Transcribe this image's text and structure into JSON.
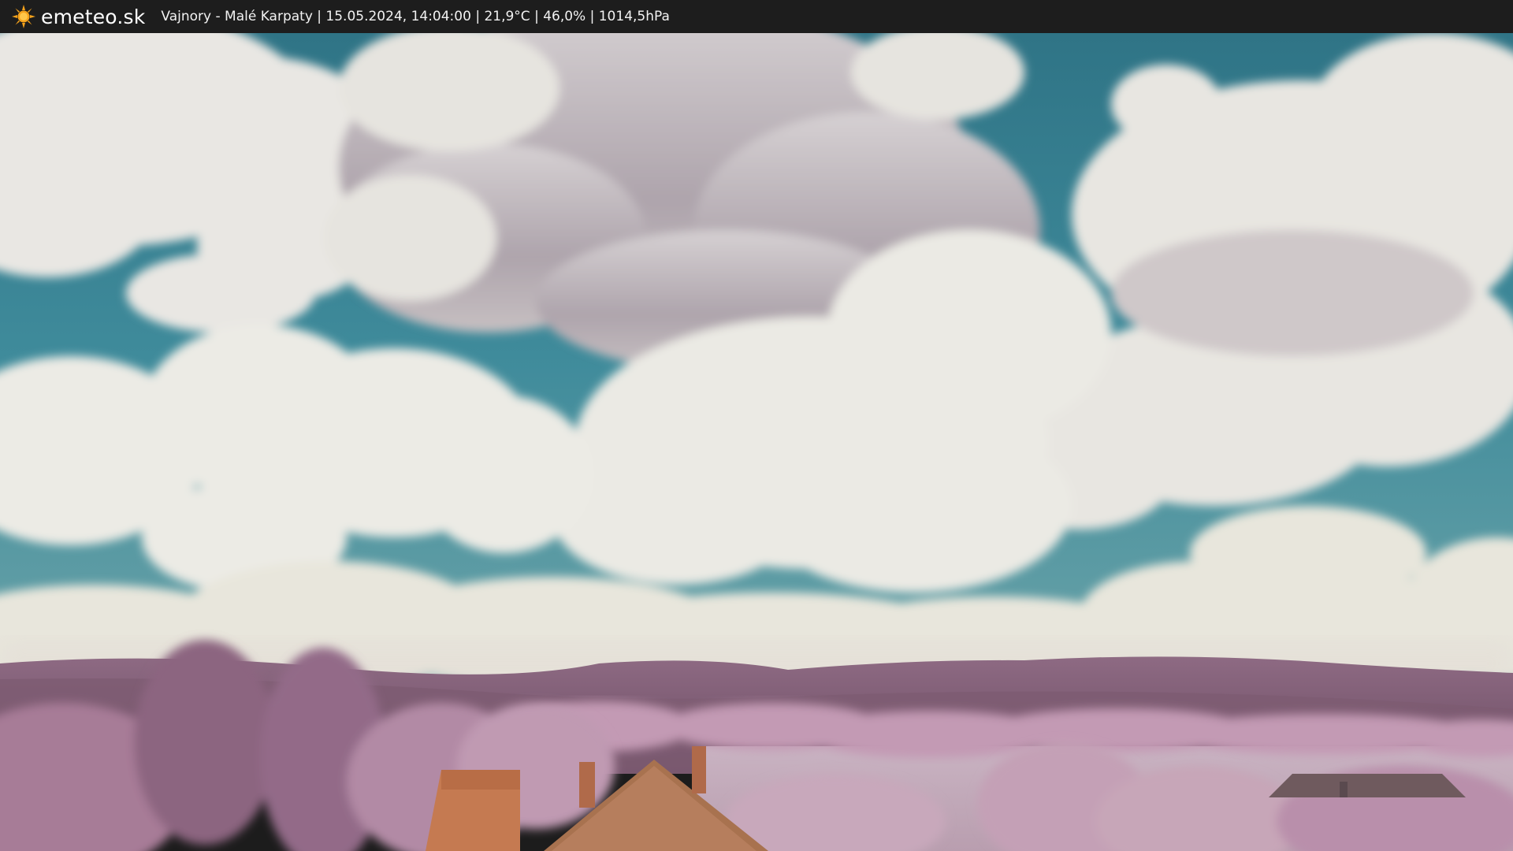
{
  "header": {
    "brand": "emeteo.sk",
    "location": "Vajnory - Malé Karpaty",
    "datetime": "15.05.2024, 14:04:00",
    "temperature": "21,9°C",
    "humidity": "46,0%",
    "pressure": "1014,5hPa",
    "caption": "Vajnory - Malé Karpaty | 15.05.2024, 14:04:00 | 21,9°C | 46,0% | 1014,5hPa",
    "logo_icon": "sun-icon"
  },
  "colors": {
    "bar_background": "#1d1d1d",
    "sun_orange": "#f5a21b",
    "sky_blue": "#3f8597",
    "cloud_white": "#ecebe6",
    "foliage_pink": "#b48aa6",
    "roof_orange": "#c77a4f"
  },
  "scene": {
    "description_icon": "webcam-image"
  }
}
